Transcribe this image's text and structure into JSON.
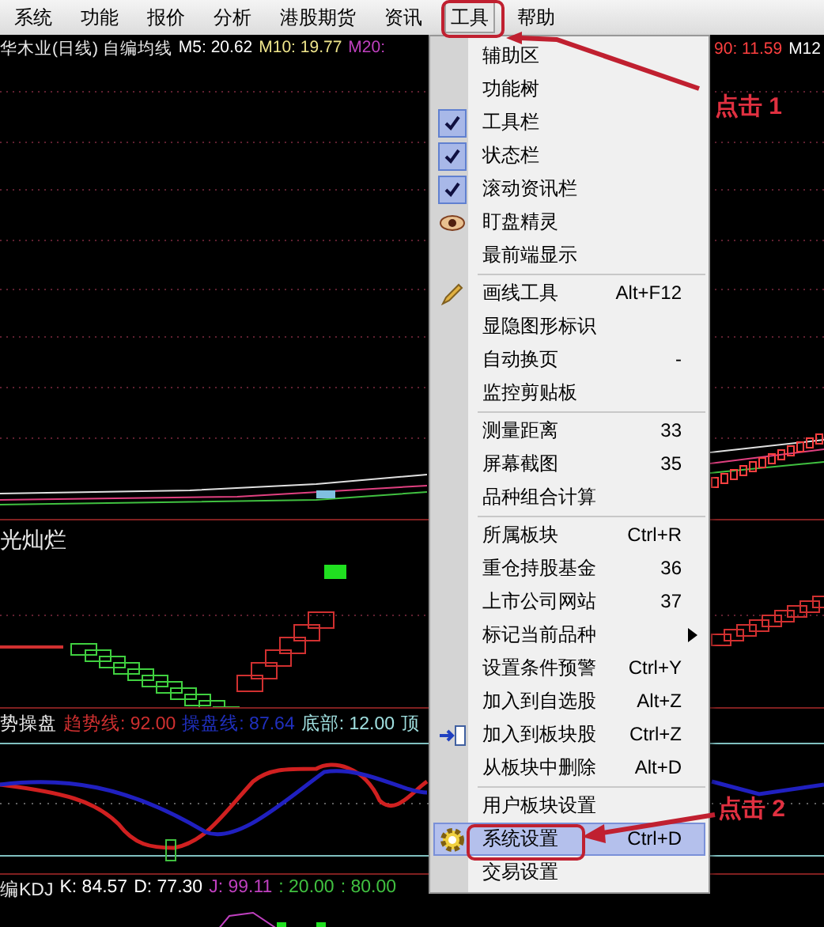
{
  "menubar": [
    {
      "label": "系统",
      "selected": false
    },
    {
      "label": "功能",
      "selected": false
    },
    {
      "label": "报价",
      "selected": false
    },
    {
      "label": "分析",
      "selected": false
    },
    {
      "label": "港股期货",
      "selected": false
    },
    {
      "label": "资讯",
      "selected": false
    },
    {
      "label": "工具",
      "selected": true
    },
    {
      "label": "帮助",
      "selected": false
    }
  ],
  "price_chart": {
    "legend": [
      {
        "text": "华木业(日线) 自编均线",
        "color": "#e8e8e8"
      },
      {
        "text": "M5: 20.62",
        "color": "#ffffff"
      },
      {
        "text": "M10: 19.77",
        "color": "#f0e68c"
      },
      {
        "text": "M20:",
        "color": "#c040c0"
      }
    ],
    "legend_right": [
      {
        "text": "90: 11.59",
        "color": "#ff4040"
      },
      {
        "text": "M12",
        "color": "#ffffff"
      }
    ]
  },
  "signal_pane": {
    "title": "光灿烂"
  },
  "trend_pane": {
    "legend": [
      {
        "text": "势操盘",
        "color": "#e8e8e8"
      },
      {
        "text": "趋势线: 92.00",
        "color": "#d03030"
      },
      {
        "text": "操盘线: 87.64",
        "color": "#2030c0"
      },
      {
        "text": "底部: 12.00",
        "color": "#a0e0e0"
      },
      {
        "text": "顶",
        "color": "#a0e0e0"
      }
    ]
  },
  "kdj_pane": {
    "legend": [
      {
        "text": "编KDJ",
        "color": "#e8e8e8"
      },
      {
        "text": "K: 84.57",
        "color": "#ffffff"
      },
      {
        "text": "D: 77.30",
        "color": "#ffffff"
      },
      {
        "text": "J: 99.11",
        "color": "#c040c0"
      },
      {
        "text": ": 20.00",
        "color": "#40c040"
      },
      {
        "text": ": 80.00",
        "color": "#40c040"
      }
    ]
  },
  "tools_menu": [
    {
      "kind": "item",
      "label": "辅助区",
      "checked": false,
      "selected": false
    },
    {
      "kind": "item",
      "label": "功能树",
      "checked": false,
      "selected": false
    },
    {
      "kind": "item",
      "label": "工具栏",
      "checked": true,
      "selected": false
    },
    {
      "kind": "item",
      "label": "状态栏",
      "checked": true,
      "selected": false
    },
    {
      "kind": "item",
      "label": "滚动资讯栏",
      "checked": true,
      "selected": false
    },
    {
      "kind": "eye",
      "label": "盯盘精灵",
      "checked": false,
      "selected": false
    },
    {
      "kind": "item",
      "label": "最前端显示",
      "checked": false,
      "selected": false
    },
    {
      "kind": "separator"
    },
    {
      "kind": "pencil",
      "label": "画线工具",
      "shortcut": "Alt+F12",
      "checked": false,
      "selected": false
    },
    {
      "kind": "item",
      "label": "显隐图形标识",
      "checked": false,
      "selected": false
    },
    {
      "kind": "item",
      "label": "自动换页",
      "shortcut": "-",
      "checked": false,
      "selected": false
    },
    {
      "kind": "item",
      "label": "监控剪贴板",
      "checked": false,
      "selected": false
    },
    {
      "kind": "separator"
    },
    {
      "kind": "item",
      "label": "测量距离",
      "shortcut": "33",
      "checked": false,
      "selected": false
    },
    {
      "kind": "item",
      "label": "屏幕截图",
      "shortcut": "35",
      "checked": false,
      "selected": false
    },
    {
      "kind": "item",
      "label": "品种组合计算",
      "checked": false,
      "selected": false
    },
    {
      "kind": "separator"
    },
    {
      "kind": "item",
      "label": "所属板块",
      "shortcut": "Ctrl+R",
      "checked": false,
      "selected": false
    },
    {
      "kind": "item",
      "label": "重仓持股基金",
      "shortcut": "36",
      "checked": false,
      "selected": false
    },
    {
      "kind": "item",
      "label": "上市公司网站",
      "shortcut": "37",
      "checked": false,
      "selected": false
    },
    {
      "kind": "submenu",
      "label": "标记当前品种",
      "checked": false,
      "selected": false
    },
    {
      "kind": "item",
      "label": "设置条件预警",
      "shortcut": "Ctrl+Y",
      "checked": false,
      "selected": false
    },
    {
      "kind": "item",
      "label": "加入到自选股",
      "shortcut": "Alt+Z",
      "checked": false,
      "selected": false
    },
    {
      "kind": "arrow",
      "label": "加入到板块股",
      "shortcut": "Ctrl+Z",
      "checked": false,
      "selected": false
    },
    {
      "kind": "item",
      "label": "从板块中删除",
      "shortcut": "Alt+D",
      "checked": false,
      "selected": false
    },
    {
      "kind": "separator"
    },
    {
      "kind": "item",
      "label": "用户板块设置",
      "checked": false,
      "selected": false
    },
    {
      "kind": "gear",
      "label": "系统设置",
      "shortcut": "Ctrl+D",
      "checked": false,
      "selected": true
    },
    {
      "kind": "item",
      "label": "交易设置",
      "checked": false,
      "selected": false
    }
  ],
  "annotations": [
    {
      "text": "点击 1"
    },
    {
      "text": "点击 2"
    }
  ]
}
